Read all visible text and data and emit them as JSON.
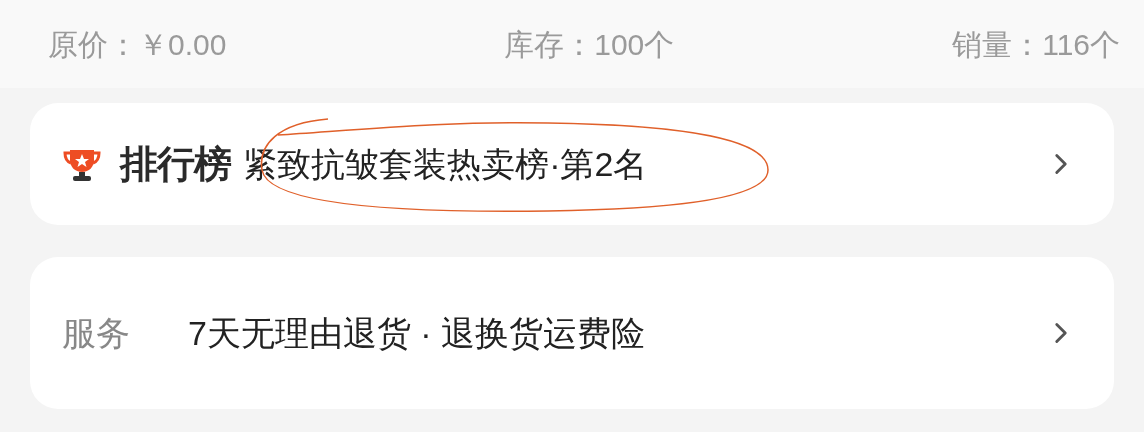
{
  "stats": [
    {
      "label": "原价：",
      "value": "￥0.00"
    },
    {
      "label": "库存：",
      "value": "100个"
    },
    {
      "label": "销量：",
      "value": "116个"
    }
  ],
  "ranking": {
    "badge": "排行榜",
    "text": "紧致抗皱套装热卖榜·第2名",
    "annotated": true
  },
  "service": {
    "label": "服务",
    "text": "7天无理由退货 · 退换货运费险"
  }
}
